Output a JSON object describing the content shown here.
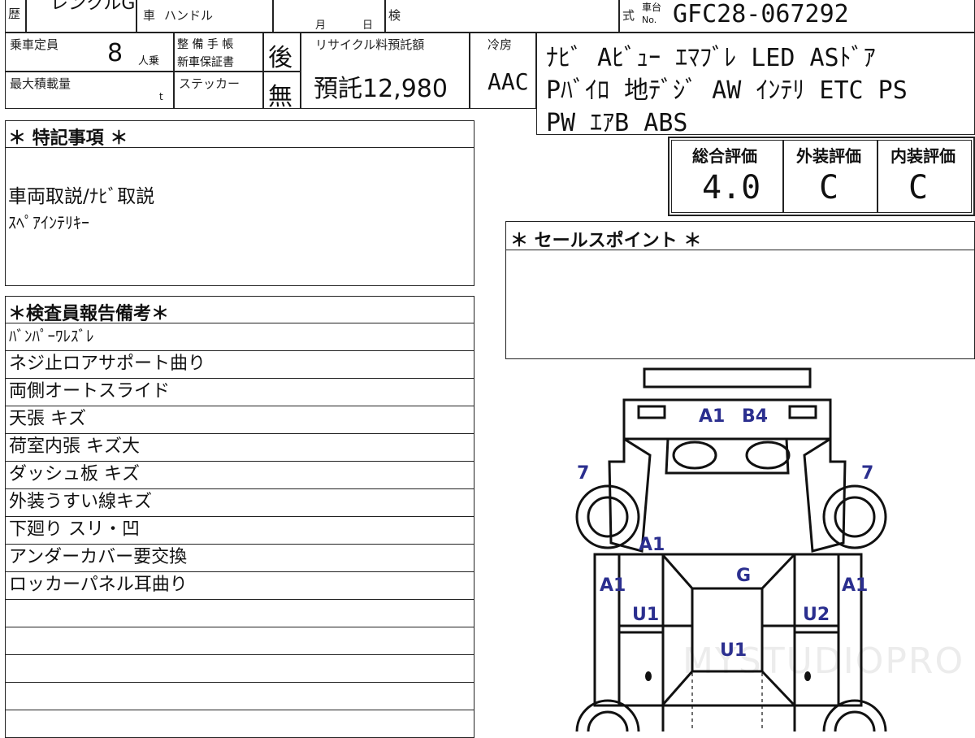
{
  "top": {
    "history_char": "歴",
    "model_fragment": "レンクルGT",
    "vehicle_char": "車",
    "handle_label": "ハンドル",
    "month_label": "月",
    "day_label": "日",
    "inspect_char": "検",
    "type_char": "式",
    "chassis_label_top": "車台",
    "chassis_label_no": "No.",
    "chassis_number": "GFC28-067292"
  },
  "info": {
    "capacity_label": "乗車定員",
    "capacity_value": "8",
    "capacity_unit": "人乗",
    "maint_label_1": "整 備 手 帳",
    "maint_label_2": "新車保証書",
    "maint_value": "後",
    "recycle_label": "リサイクル料預託額",
    "recycle_value": "預託12,980",
    "ac_label": "冷房",
    "ac_value": "AAC",
    "load_label": "最大積載量",
    "load_unit": "t",
    "sticker_label": "ステッカー",
    "sticker_value": "無"
  },
  "equipment": [
    "ﾅﾋﾞ Aﾋﾞｭｰ ｴﾏﾌﾞﾚ LED ASﾄﾞｱ",
    "Pﾊﾞｲﾛ 地ﾃﾞｼﾞ AW ｲﾝﾃﾘ ETC PS",
    "PW ｴｱB ABS"
  ],
  "scores": {
    "overall_label": "総合評価",
    "overall_value": "4.0",
    "exterior_label": "外装評価",
    "exterior_value": "C",
    "interior_label": "内装評価",
    "interior_value": "C"
  },
  "special": {
    "title": "＊ 特記事項 ＊",
    "lines": [
      "車両取説/ﾅﾋﾞ取説",
      "ｽﾍﾟｱｲﾝﾃﾘｷｰ"
    ]
  },
  "sales": {
    "title": "＊ セールスポイント ＊"
  },
  "inspector": {
    "title": "＊検査員報告備考＊",
    "lines": [
      "ﾊﾞﾝﾊﾟｰﾜﾚｽﾞﾚ",
      "ネジ止ロアサポート曲り",
      "両側オートスライド",
      "天張 キズ",
      "荷室内張 キズ大",
      "ダッシュ板 キズ",
      "外装うすい線キズ",
      "下廻り スリ・凹",
      "アンダーカバー要交換",
      "ロッカーパネル耳曲り",
      "",
      "",
      "",
      "",
      ""
    ]
  },
  "diagram": {
    "labels": [
      "A1",
      "B4",
      "7",
      "7",
      "A1",
      "A1",
      "A1",
      "G",
      "U1",
      "U2",
      "U1"
    ],
    "watermark": "MYSTUDIOPRO",
    "ink_color": "#2b2f8f"
  }
}
